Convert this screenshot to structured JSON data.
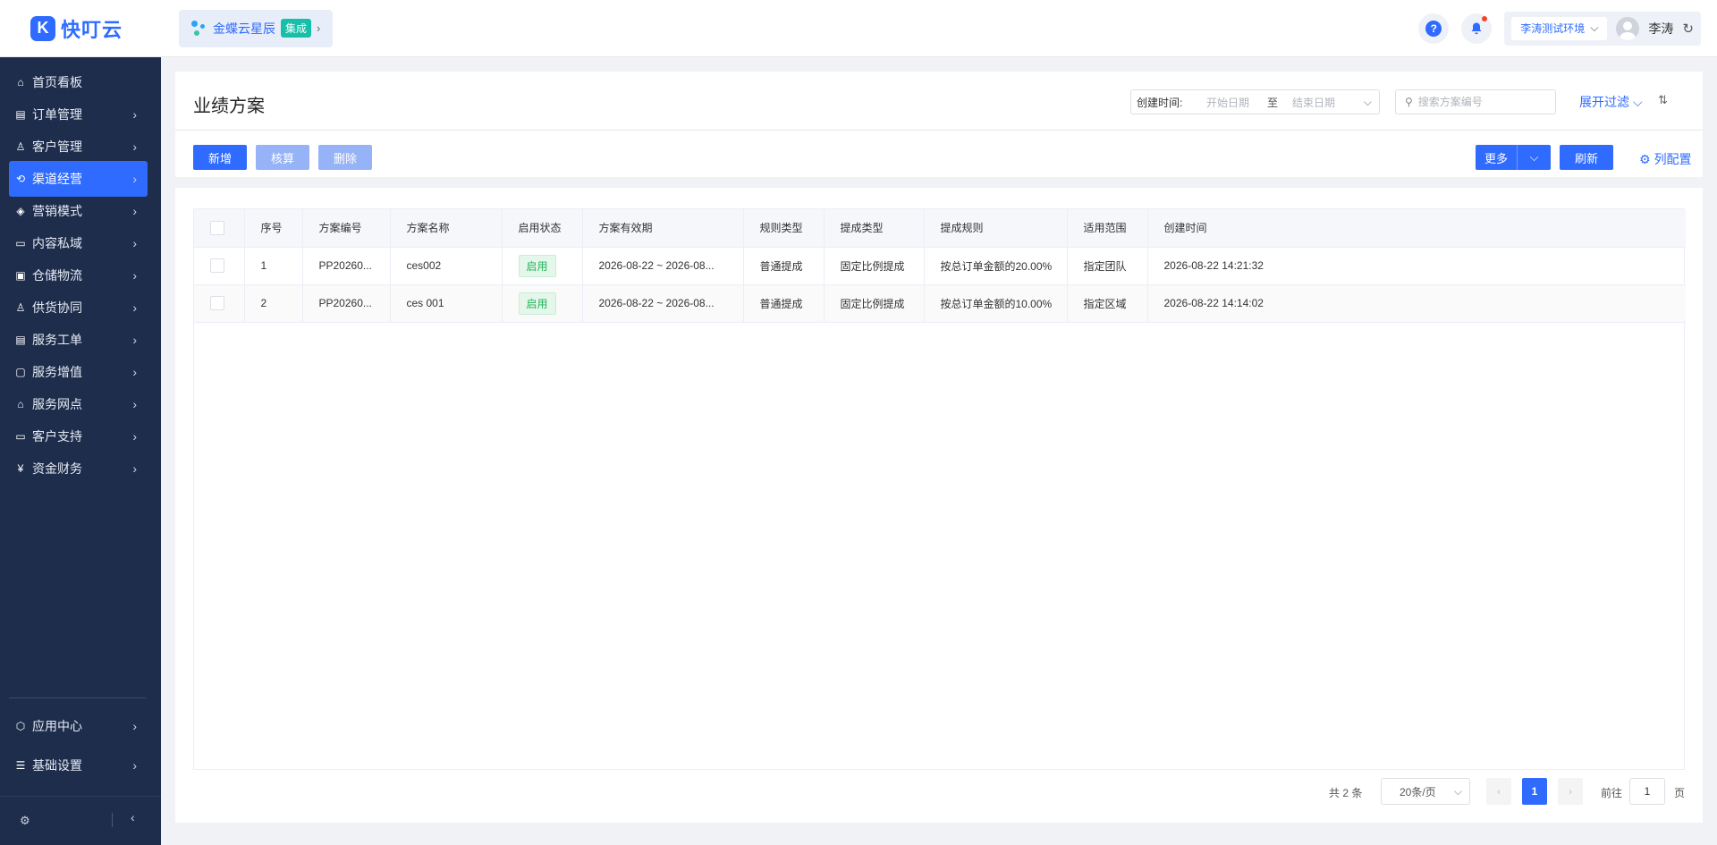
{
  "app": {
    "logo_mark": "K",
    "logo_text": "快叮云",
    "product_name": "金蝶云星辰",
    "product_tag": "集成"
  },
  "header": {
    "help_icon_text": "?",
    "environment": "李涛测试环境",
    "user_name": "李涛"
  },
  "sidebar": {
    "items": [
      {
        "label": "首页看板",
        "icon": "home-icon",
        "glyph": "⌂",
        "has_chevron": false
      },
      {
        "label": "订单管理",
        "icon": "order-icon",
        "glyph": "▤",
        "has_chevron": true
      },
      {
        "label": "客户管理",
        "icon": "customer-icon",
        "glyph": "♙",
        "has_chevron": true
      },
      {
        "label": "渠道经营",
        "icon": "channel-icon",
        "glyph": "⟲",
        "has_chevron": true,
        "active": true
      },
      {
        "label": "营销模式",
        "icon": "tag-icon",
        "glyph": "◈",
        "has_chevron": true
      },
      {
        "label": "内容私域",
        "icon": "image-icon",
        "glyph": "▭",
        "has_chevron": true
      },
      {
        "label": "仓储物流",
        "icon": "warehouse-icon",
        "glyph": "▣",
        "has_chevron": true
      },
      {
        "label": "供货协同",
        "icon": "supply-icon",
        "glyph": "♙",
        "has_chevron": true
      },
      {
        "label": "服务工单",
        "icon": "ticket-icon",
        "glyph": "▤",
        "has_chevron": true
      },
      {
        "label": "服务增值",
        "icon": "bag-icon",
        "glyph": "▢",
        "has_chevron": true
      },
      {
        "label": "服务网点",
        "icon": "store-icon",
        "glyph": "⌂",
        "has_chevron": true
      },
      {
        "label": "客户支持",
        "icon": "support-icon",
        "glyph": "▭",
        "has_chevron": true
      },
      {
        "label": "资金财务",
        "icon": "yen-icon",
        "glyph": "¥",
        "has_chevron": true
      }
    ],
    "bottom_items": [
      {
        "label": "应用中心",
        "icon": "cube-icon",
        "glyph": "⬡",
        "has_chevron": true
      },
      {
        "label": "基础设置",
        "icon": "settings-list-icon",
        "glyph": "☰",
        "has_chevron": true
      }
    ]
  },
  "page": {
    "title": "业绩方案",
    "date_filter": {
      "label": "创建时间:",
      "start_placeholder": "开始日期",
      "separator": "至",
      "end_placeholder": "结束日期"
    },
    "search_placeholder": "搜索方案编号",
    "expand_filter": "展开过滤"
  },
  "toolbar": {
    "add": "新增",
    "calculate": "核算",
    "delete": "删除",
    "more": "更多",
    "refresh": "刷新",
    "column_config": "列配置"
  },
  "table": {
    "columns": [
      "序号",
      "方案编号",
      "方案名称",
      "启用状态",
      "方案有效期",
      "规则类型",
      "提成类型",
      "提成规则",
      "适用范围",
      "创建时间"
    ],
    "rows": [
      {
        "index": "1",
        "code": "PP20260...",
        "name": "ces002",
        "status": "启用",
        "validity": "2026-08-22 ~ 2026-08...",
        "rule_type": "普通提成",
        "commission_type": "固定比例提成",
        "commission_rule": "按总订单金额的20.00%",
        "scope": "指定团队",
        "created": "2026-08-22 14:21:32"
      },
      {
        "index": "2",
        "code": "PP20260...",
        "name": "ces 001",
        "status": "启用",
        "validity": "2026-08-22 ~ 2026-08...",
        "rule_type": "普通提成",
        "commission_type": "固定比例提成",
        "commission_rule": "按总订单金额的10.00%",
        "scope": "指定区域",
        "created": "2026-08-22 14:14:02"
      }
    ]
  },
  "pagination": {
    "total": "共 2 条",
    "page_size": "20条/页",
    "current_page": "1",
    "goto_label": "前往",
    "goto_value": "1",
    "page_unit": "页"
  },
  "colors": {
    "primary": "#2f6bff",
    "sidebar_bg": "#1f2d4c",
    "status_green": "#24b35a"
  }
}
